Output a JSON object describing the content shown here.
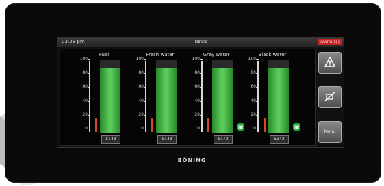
{
  "status_bar": {
    "time": "03:38 pm",
    "title": "Tanks",
    "alarm_label": "Alarm (1)"
  },
  "scale_ticks": [
    "100",
    "80",
    "60",
    "40",
    "20",
    "0"
  ],
  "tanks": [
    {
      "name": "Fuel",
      "level_percent": 100,
      "value": "5143",
      "valve": false,
      "low_marker": true
    },
    {
      "name": "Fresh water",
      "level_percent": 100,
      "value": "5143",
      "valve": false,
      "low_marker": true
    },
    {
      "name": "Grey water",
      "level_percent": 100,
      "value": "5143",
      "valve": true,
      "low_marker": true
    },
    {
      "name": "Black water",
      "level_percent": 100,
      "value": "5143",
      "valve": true,
      "low_marker": true
    }
  ],
  "side_buttons": [
    {
      "icon": "warning-icon"
    },
    {
      "icon": "alarm-mute-icon"
    },
    {
      "label": "Menu"
    }
  ],
  "brand": "BÖNING",
  "colors": {
    "fill": "#5ed05e",
    "alarm": "#c62323",
    "low_marker": "#d44a1a",
    "valve": "#23a83a"
  }
}
